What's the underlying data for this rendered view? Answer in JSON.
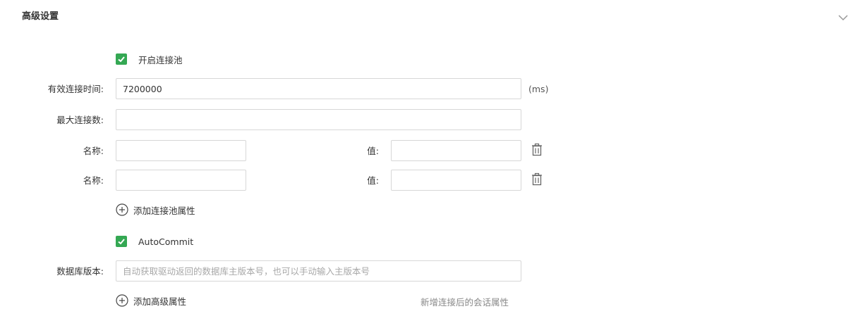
{
  "section": {
    "title": "高级设置"
  },
  "pool": {
    "enable_label": "开启连接池",
    "enabled": true,
    "valid_time_label": "有效连接时间:",
    "valid_time_value": "7200000",
    "valid_time_unit": "(ms)",
    "max_conn_label": "最大连接数:",
    "max_conn_value": "",
    "properties": [
      {
        "name_label": "名称:",
        "name_value": "",
        "value_label": "值:",
        "value_value": ""
      },
      {
        "name_label": "名称:",
        "name_value": "",
        "value_label": "值:",
        "value_value": ""
      }
    ],
    "add_property_label": "添加连接池属性"
  },
  "advanced": {
    "autocommit_label": "AutoCommit",
    "autocommit_enabled": true,
    "db_version_label": "数据库版本:",
    "db_version_placeholder": "自动获取驱动返回的数据库主版本号，也可以手动输入主版本号",
    "db_version_value": "",
    "add_advanced_label": "添加高级属性",
    "hint": "新增连接后的会话属性"
  },
  "icons": {
    "collapse": "chevron-down-icon",
    "check": "check-icon",
    "delete": "trash-icon",
    "add": "plus-circle-icon"
  },
  "colors": {
    "checkbox": "#34a853",
    "border": "#d7d7d7",
    "hint": "#888888"
  }
}
